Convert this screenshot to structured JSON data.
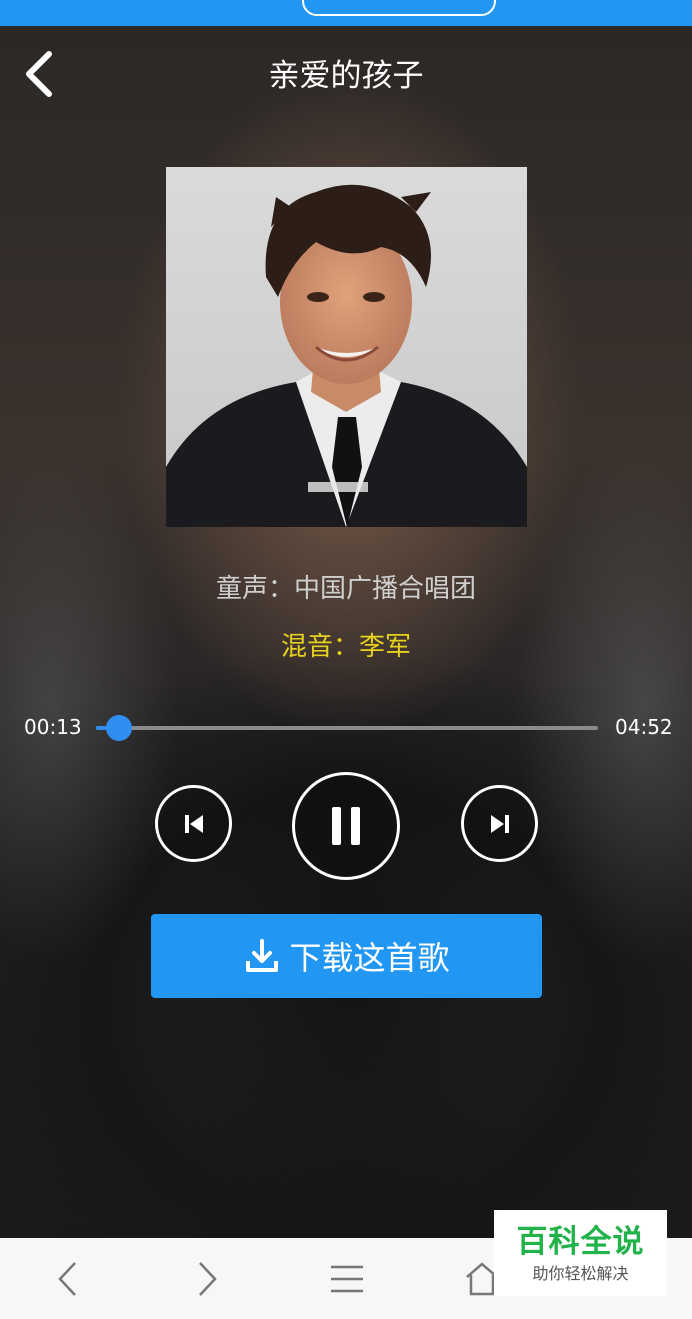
{
  "header": {
    "title": "亲爱的孩子"
  },
  "song": {
    "credit_vocals": "童声：中国广播合唱团",
    "credit_mix": "混音：李军"
  },
  "player": {
    "current_time": "00:13",
    "total_time": "04:52",
    "progress": 0.045
  },
  "actions": {
    "download_label": "下载这首歌"
  },
  "watermark": {
    "title": "百科全说",
    "subtitle": "助你轻松解决"
  },
  "colors": {
    "accent": "#2196f3",
    "mix_credit": "#e6d21c",
    "watermark_green": "#21b24a"
  }
}
